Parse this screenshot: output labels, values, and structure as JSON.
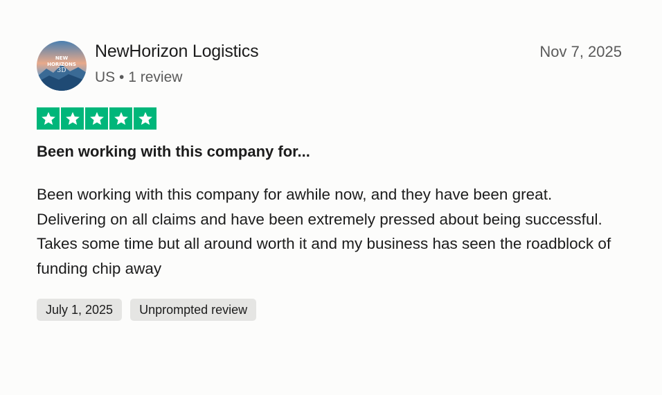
{
  "reviewer": {
    "name": "NewHorizon Logistics",
    "country": "US",
    "separator": "•",
    "review_count": "1 review",
    "avatar_text_line1": "NEW",
    "avatar_text_line2": "HORIZONS",
    "avatar_text_line3": "3D"
  },
  "review": {
    "posted_date": "Nov 7, 2025",
    "rating": 5,
    "rating_max": 5,
    "title": "Been working with this company for...",
    "body": "Been working with this company for awhile now, and they have been great. Delivering on all claims and have been extremely pressed about being successful. Takes some time but all around worth it and my business has seen the roadblock of funding chip away",
    "tags": [
      "July 1, 2025",
      "Unprompted review"
    ]
  },
  "colors": {
    "star_green": "#00b67a",
    "tag_bg": "#e5e5e3",
    "muted_text": "#5a5a5a"
  }
}
